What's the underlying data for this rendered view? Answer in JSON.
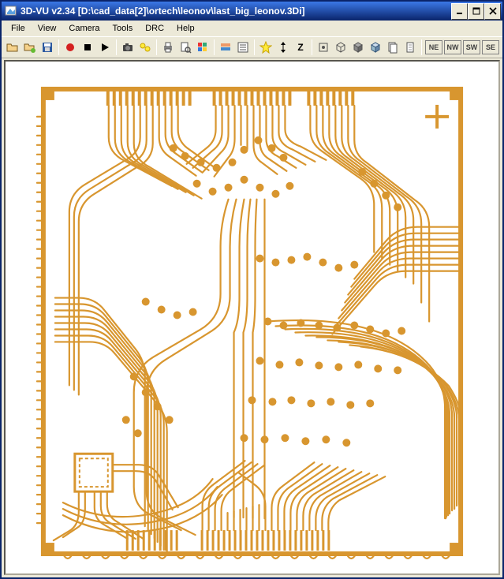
{
  "app_name": "3D-VU",
  "version": "v2.34",
  "file_path": "D:\\cad_data[2]\\ortech\\leonov\\last_big_leonov.3Di",
  "title_text": "3D-VU v2.34 [D:\\cad_data[2]\\ortech\\leonov\\last_big_leonov.3Di]",
  "menu": {
    "file": "File",
    "view": "View",
    "camera": "Camera",
    "tools": "Tools",
    "drc": "DRC",
    "help": "Help"
  },
  "toolbar": {
    "open": "open",
    "save": "save",
    "disk": "disk",
    "record": "record",
    "stop": "stop",
    "play": "play",
    "camera_snap": "snapshot",
    "lights": "lights",
    "print": "print",
    "preview": "preview",
    "palette": "palette",
    "layers": "layers",
    "settings": "settings",
    "star": "star",
    "z_arrows": "z-axis",
    "z_label": "Z",
    "pad": "pad",
    "cube1": "wire-cube",
    "cube2": "solid-cube",
    "cube3": "shaded-cube",
    "docs": "docs",
    "sheet": "sheet",
    "ne": "NE",
    "nw": "NW",
    "sw": "SW",
    "se": "SE",
    "info": "info"
  },
  "canvas": {
    "description": "PCB copper trace layout, single layer view",
    "trace_color": "#d8962f",
    "background_color": "#ffffff"
  }
}
